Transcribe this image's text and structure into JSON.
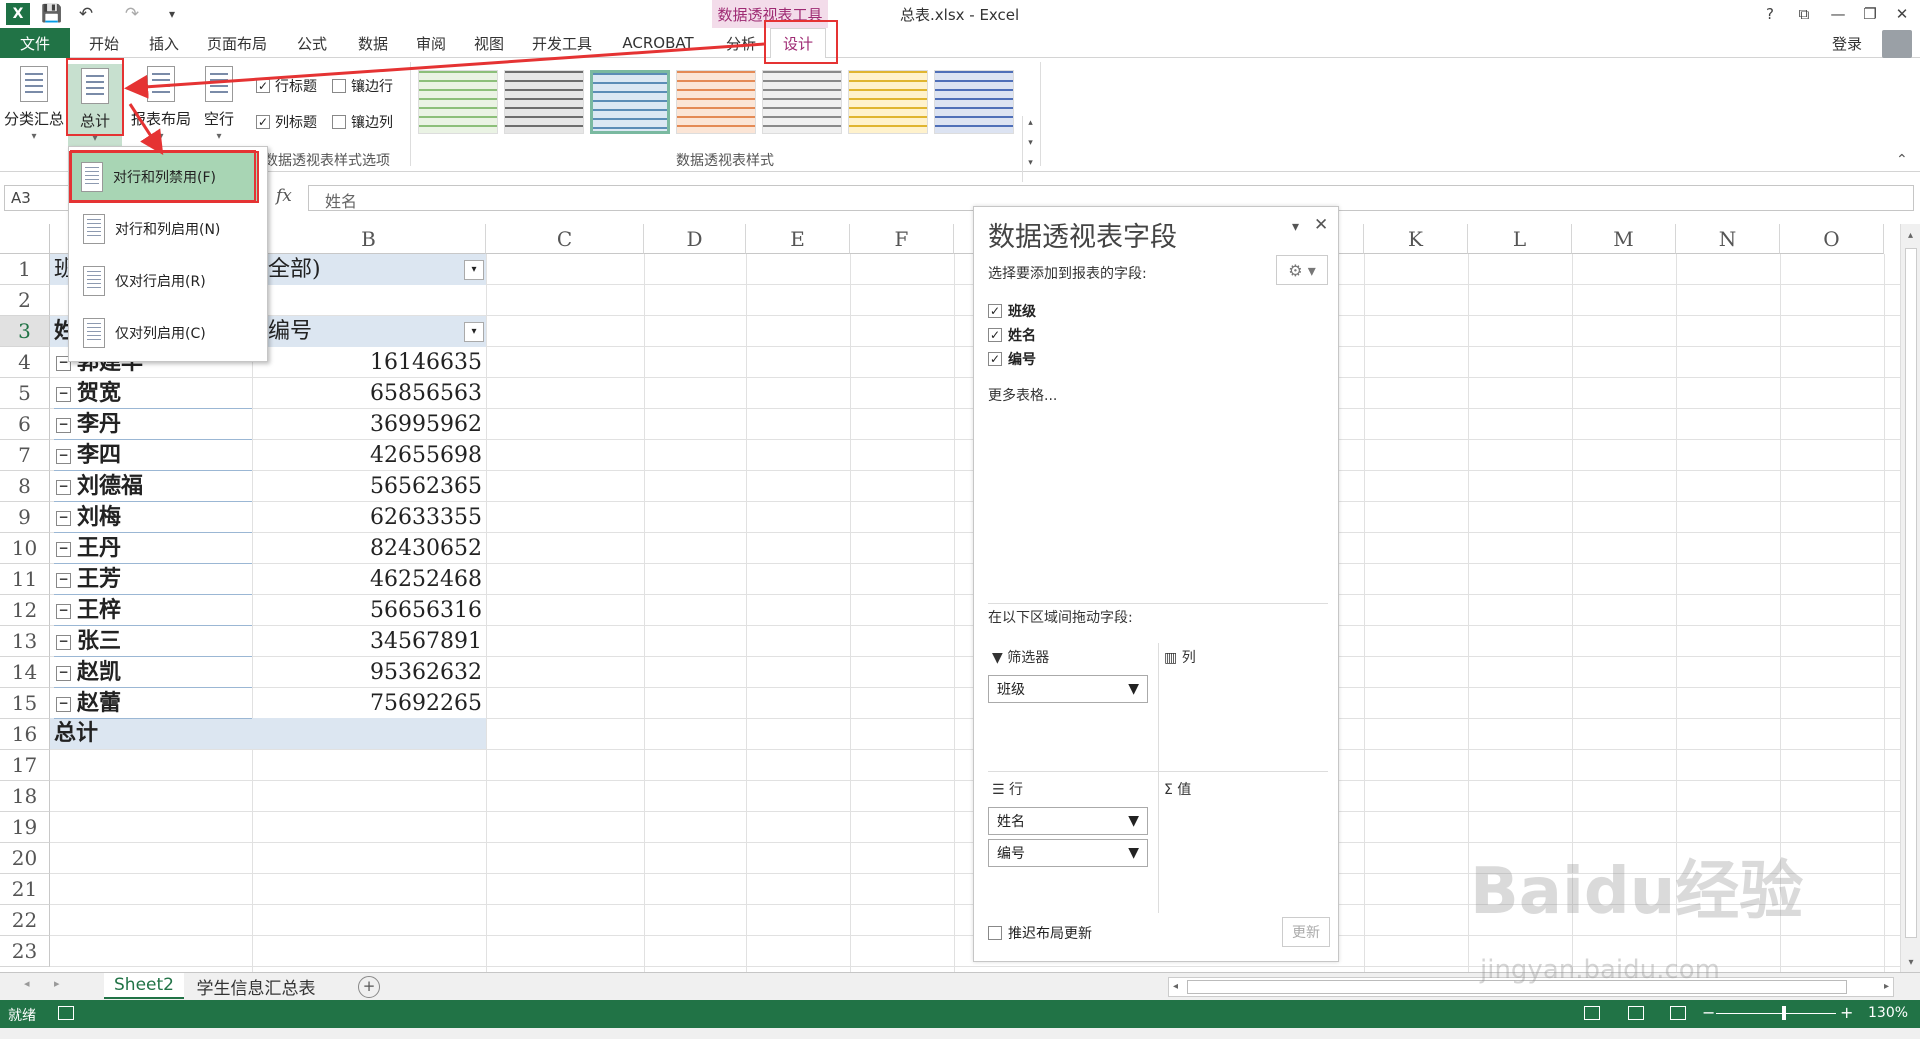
{
  "titlebar": {
    "doc_title": "总表.xlsx - Excel",
    "context_tools": "数据透视表工具",
    "help": "?",
    "restore": "⧉",
    "minimize": "—",
    "maximize": "❐",
    "close": "✕",
    "app_logo": "X"
  },
  "tabs": {
    "file": "文件",
    "home": "开始",
    "insert": "插入",
    "layout": "页面布局",
    "formulas": "公式",
    "data": "数据",
    "review": "审阅",
    "view": "视图",
    "dev": "开发工具",
    "acrobat": "ACROBAT",
    "analyze": "分析",
    "design": "设计",
    "login": "登录"
  },
  "ribbon": {
    "subtotal": "分类汇总",
    "grandtotal": "总计",
    "report_layout": "报表布局",
    "blank_rows": "空行",
    "row_headers": "行标题",
    "banded_rows": "镶边行",
    "col_headers": "列标题",
    "banded_cols": "镶边列",
    "style_options_label": "数据透视表样式选项",
    "styles_label": "数据透视表样式",
    "checkmark": "✓"
  },
  "style_swatches": [
    {
      "color": "#8cbf7a",
      "bg": "#eaf3e4"
    },
    {
      "color": "#6d6d6d",
      "bg": "#e6e6e6"
    },
    {
      "color": "#5b8db6",
      "bg": "#dbe8f3",
      "selected": true
    },
    {
      "color": "#e48a55",
      "bg": "#fbe5d6"
    },
    {
      "color": "#8a8a8a",
      "bg": "#f0f0f0"
    },
    {
      "color": "#e0b530",
      "bg": "#fff2cc"
    },
    {
      "color": "#4f6fb8",
      "bg": "#dce3f2"
    }
  ],
  "formula_bar": {
    "namebox": "A3",
    "fx": "fx",
    "content": "姓名"
  },
  "columns": [
    "B",
    "C",
    "D",
    "E",
    "F",
    "K",
    "L",
    "M",
    "N",
    "O"
  ],
  "rows": [
    "1",
    "2",
    "3",
    "4",
    "5",
    "6",
    "7",
    "8",
    "9",
    "10",
    "11",
    "12",
    "13",
    "14",
    "15",
    "16",
    "17",
    "18",
    "19",
    "20",
    "21",
    "22",
    "23"
  ],
  "pivot": {
    "r1_label": "班",
    "r1_value": "全部)",
    "r3_label": "姓",
    "r3_value": "编号",
    "first_name_partial": "郭建华",
    "names": [
      "贺宽",
      "李丹",
      "李四",
      "刘德福",
      "刘梅",
      "王丹",
      "王芳",
      "王梓",
      "张三",
      "赵凯",
      "赵蕾"
    ],
    "first_value": "16146635",
    "values": [
      "65856563",
      "36995962",
      "42655698",
      "56562365",
      "62633355",
      "82430652",
      "46252468",
      "56656316",
      "34567891",
      "95362632",
      "75692265"
    ],
    "total_label": "总计",
    "minus_sign": "−",
    "drop_arrow": "▾"
  },
  "dropdown": {
    "items": [
      "对行和列禁用(F)",
      "对行和列启用(N)",
      "仅对行启用(R)",
      "仅对列启用(C)"
    ]
  },
  "fields_panel": {
    "title": "数据透视表字段",
    "choose_label": "选择要添加到报表的字段:",
    "fields": [
      "班级",
      "姓名",
      "编号"
    ],
    "more_tables": "更多表格...",
    "drag_label": "在以下区域间拖动字段:",
    "filter_label": "筛选器",
    "columns_label": "列",
    "rows_label": "行",
    "values_label": "值",
    "filter_item": "班级",
    "row_items": [
      "姓名",
      "编号"
    ],
    "defer_label": "推迟布局更新",
    "update_btn": "更新",
    "close": "✕",
    "menu": "▾",
    "gear": "⚙"
  },
  "sheets": {
    "active": "Sheet2",
    "other": "学生信息汇总表",
    "add": "+"
  },
  "status": {
    "ready": "就绪",
    "zoom": "130%",
    "minus": "−",
    "plus": "+"
  },
  "watermark": {
    "main": "Baidu经验",
    "sub": "jingyan.baidu.com"
  }
}
